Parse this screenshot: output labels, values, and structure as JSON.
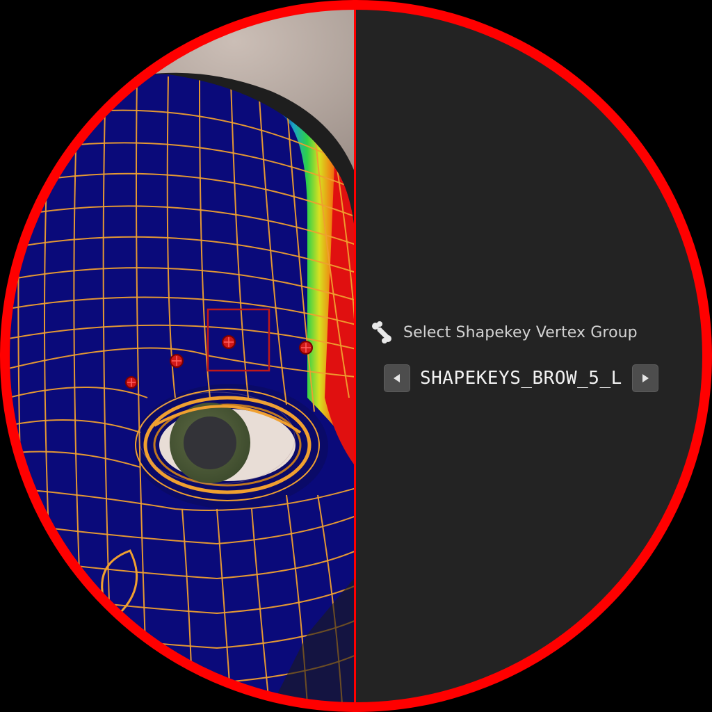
{
  "panel": {
    "title": "Select Shapekey Vertex Group",
    "title_icon": "bone-icon",
    "vertex_group": "SHAPEKEYS_BROW_5_L",
    "prev_icon": "triangle-left-icon",
    "next_icon": "triangle-right-icon"
  },
  "colors": {
    "lens_ring": "#ff0000",
    "panel_bg": "#232323",
    "weight_zero": "#0a0a7a",
    "weight_full": "#e01010",
    "wireframe": "#f0a030",
    "bone_marker": "#d01818"
  }
}
